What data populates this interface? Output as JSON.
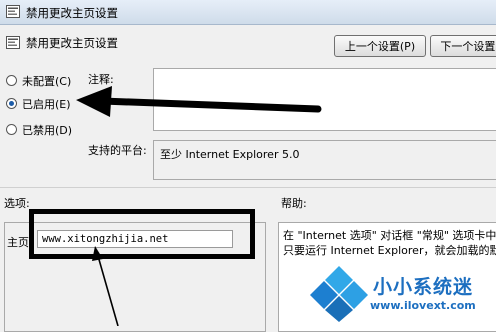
{
  "window": {
    "title": "禁用更改主页设置"
  },
  "header": {
    "title": "禁用更改主页设置",
    "prev_button": "上一个设置(P)",
    "next_button": "下一个设置("
  },
  "radio_options": [
    {
      "label": "未配置(C)",
      "checked": false
    },
    {
      "label": "已启用(E)",
      "checked": true
    },
    {
      "label": "已禁用(D)",
      "checked": false
    }
  ],
  "comment": {
    "label": "注释:",
    "value": ""
  },
  "platform": {
    "label": "支持的平台:",
    "value": "至少 Internet Explorer 5.0"
  },
  "options": {
    "label": "选项:",
    "homepage_label": "主页",
    "homepage_value": "www.xitongzhijia.net"
  },
  "help": {
    "label": "帮助:",
    "lines": [
      "在 \"Internet 选项\" 对话框 \"常规\" 选项卡中",
      "只要运行 Internet Explorer，就会加载的默认"
    ]
  },
  "watermark": {
    "name": "小小系统迷",
    "url": "www.ilovext.com"
  },
  "colors": {
    "accent": "#1c5ca8",
    "watermark": "#1d6fc0"
  },
  "icons": [
    "policy-icon",
    "arrow-annotation-icon",
    "windows-logo-icon"
  ]
}
